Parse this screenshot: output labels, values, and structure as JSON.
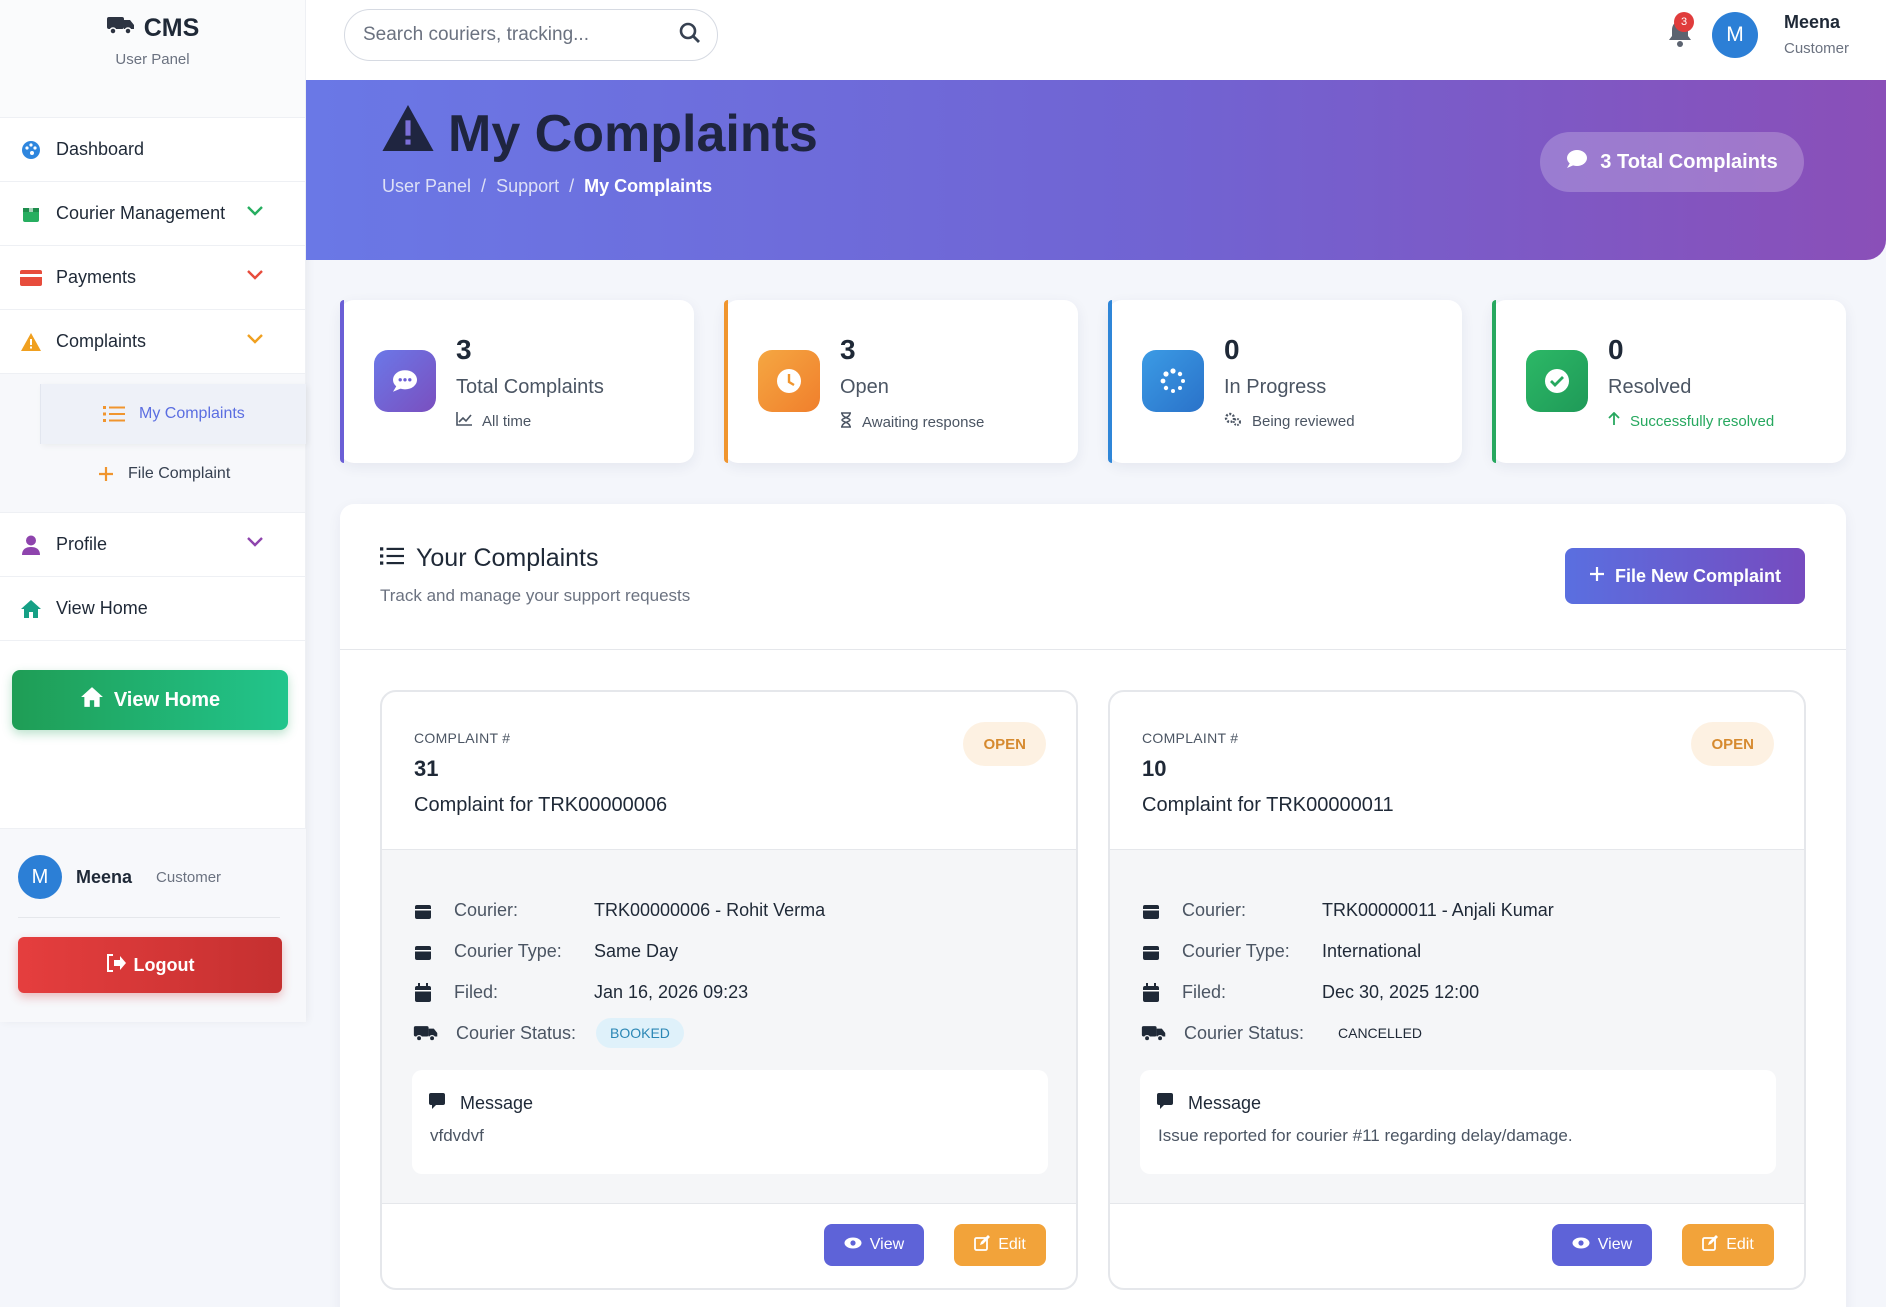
{
  "brand": {
    "title": "CMS",
    "subtitle": "User Panel"
  },
  "sidebar": {
    "items": [
      {
        "label": "Dashboard",
        "icon": "palette-icon",
        "color": "#2e86de"
      },
      {
        "label": "Courier Management",
        "icon": "box-icon",
        "color": "#27ae60"
      },
      {
        "label": "Payments",
        "icon": "credit-card-icon",
        "color": "#e74c3c"
      },
      {
        "label": "Complaints",
        "icon": "warning-icon",
        "color": "#f0a020"
      },
      {
        "label": "Profile",
        "icon": "user-icon",
        "color": "#8e44ad"
      },
      {
        "label": "View Home",
        "icon": "home-icon",
        "color": "#16a085"
      }
    ],
    "sub_items": [
      {
        "label": "My Complaints",
        "icon": "list-icon"
      },
      {
        "label": "File Complaint",
        "icon": "plus-icon"
      }
    ],
    "home_button": "View Home",
    "user": {
      "initial": "M",
      "name": "Meena",
      "role": "Customer"
    },
    "logout": "Logout"
  },
  "topbar": {
    "search_placeholder": "Search couriers, tracking...",
    "notification_count": "3",
    "user": {
      "initial": "M",
      "name": "Meena",
      "role": "Customer"
    }
  },
  "hero": {
    "title": "My Complaints",
    "breadcrumb": [
      "User Panel",
      "Support",
      "My Complaints"
    ],
    "separator": "/",
    "pill": "3 Total Complaints"
  },
  "stats": [
    {
      "value": "3",
      "label": "Total Complaints",
      "footer": "All time",
      "color": "#6b5fd6"
    },
    {
      "value": "3",
      "label": "Open",
      "footer": "Awaiting response",
      "color": "#f0952e"
    },
    {
      "value": "0",
      "label": "In Progress",
      "footer": "Being reviewed",
      "color": "#2f86d8"
    },
    {
      "value": "0",
      "label": "Resolved",
      "footer": "Successfully resolved",
      "color": "#27a85f"
    }
  ],
  "panel": {
    "title": "Your Complaints",
    "subtitle": "Track and manage your support requests",
    "file_button": "File New Complaint"
  },
  "complaints": [
    {
      "label": "COMPLAINT #",
      "number": "31",
      "subject": "Complaint for TRK00000006",
      "status": "OPEN",
      "fields": {
        "courier_key": "Courier:",
        "courier": "TRK00000006 - Rohit Verma",
        "type_key": "Courier Type:",
        "type": "Same Day",
        "filed_key": "Filed:",
        "filed": "Jan 16, 2026 09:23",
        "status_key": "Courier Status:",
        "courier_status": "BOOKED"
      },
      "message_label": "Message",
      "message": "vfdvdvf",
      "view": "View",
      "edit": "Edit"
    },
    {
      "label": "COMPLAINT #",
      "number": "10",
      "subject": "Complaint for TRK00000011",
      "status": "OPEN",
      "fields": {
        "courier_key": "Courier:",
        "courier": "TRK00000011 - Anjali Kumar",
        "type_key": "Courier Type:",
        "type": "International",
        "filed_key": "Filed:",
        "filed": "Dec 30, 2025 12:00",
        "status_key": "Courier Status:",
        "courier_status": "CANCELLED"
      },
      "message_label": "Message",
      "message": "Issue reported for courier #11 regarding delay/damage.",
      "view": "View",
      "edit": "Edit"
    }
  ]
}
